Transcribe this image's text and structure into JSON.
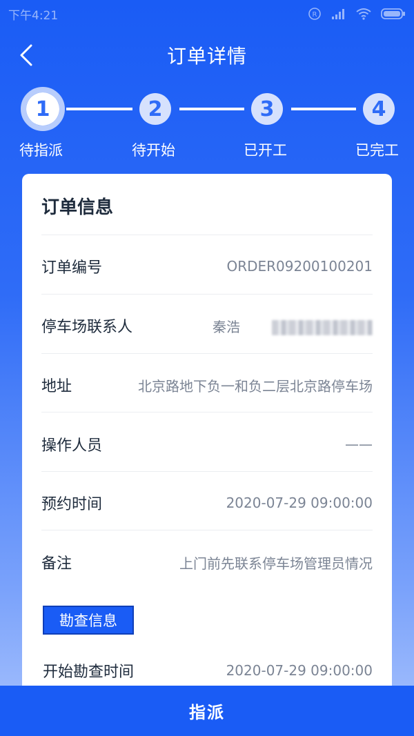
{
  "status_bar": {
    "time": "下午4:21"
  },
  "header": {
    "title": "订单详情"
  },
  "steps": [
    {
      "number": "1",
      "label": "待指派",
      "active": true
    },
    {
      "number": "2",
      "label": "待开始",
      "active": false
    },
    {
      "number": "3",
      "label": "已开工",
      "active": false
    },
    {
      "number": "4",
      "label": "已完工",
      "active": false
    }
  ],
  "order_info": {
    "title": "订单信息",
    "rows": [
      {
        "label": "订单编号",
        "value": "ORDER09200100201"
      },
      {
        "label": "停车场联系人",
        "value": "秦浩"
      },
      {
        "label": "地址",
        "value": "北京路地下负一和负二层北京路停车场"
      },
      {
        "label": "操作人员",
        "value": "——"
      },
      {
        "label": "预约时间",
        "value": "2020-07-29 09:00:00"
      },
      {
        "label": "备注",
        "value": "上门前先联系停车场管理员情况"
      }
    ]
  },
  "survey_info": {
    "tag": "勘查信息",
    "rows": [
      {
        "label": "开始勘查时间",
        "value": "2020-07-29 09:00:00"
      }
    ]
  },
  "footer": {
    "action_label": "指派"
  },
  "colors": {
    "primary": "#1a5cf5",
    "step_inactive": "#d6e1fd",
    "value_text": "#7b8494"
  }
}
